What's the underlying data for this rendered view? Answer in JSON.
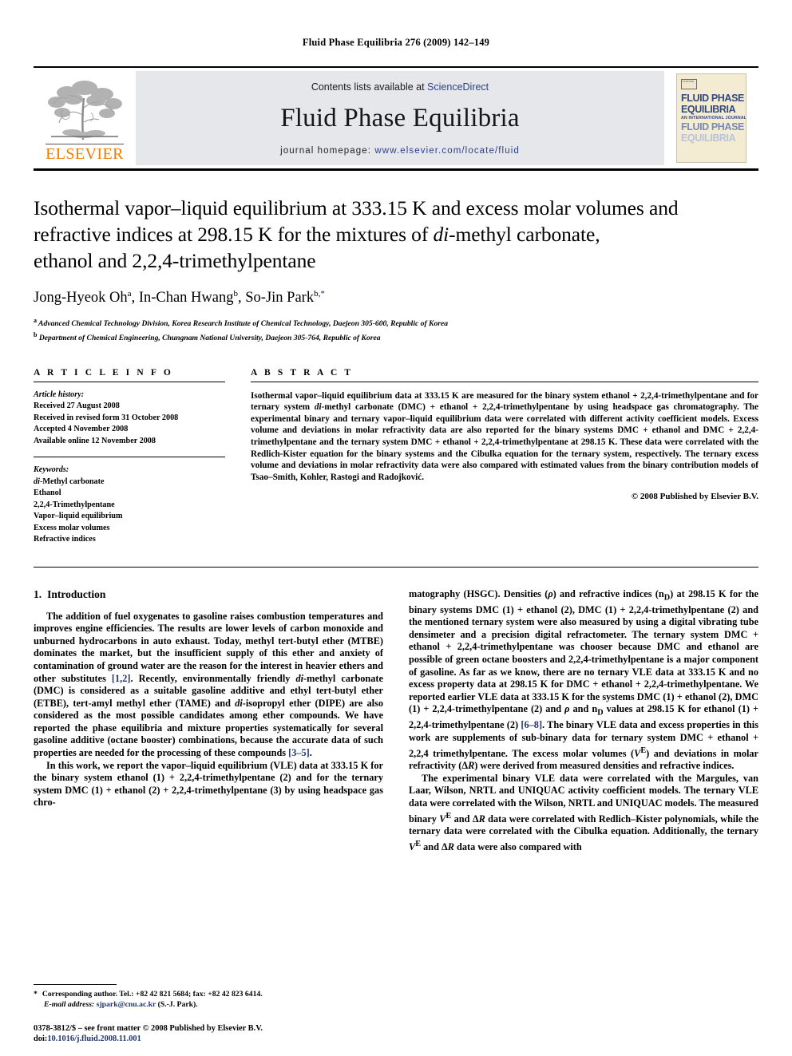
{
  "running_head": "Fluid Phase Equilibria 276 (2009) 142–149",
  "masthead": {
    "contents_prefix": "Contents lists available at ",
    "sciencedirect": "ScienceDirect",
    "journal_name": "Fluid Phase Equilibria",
    "homepage_prefix": "journal homepage:",
    "homepage_url": "www.elsevier.com/locate/fluid",
    "publisher_logo_text": "ELSEVIER",
    "logo_color": "#f07c00",
    "link_color": "#2b3f8c",
    "band_color": "#e6e7ea",
    "cover": {
      "line1": "FLUID PHASE",
      "line2": "EQUILIBRIA",
      "subtitle": "AN INTERNATIONAL JOURNAL",
      "line3": "FLUID PHASE",
      "line4": "EQUILIBRIA",
      "badge_text": "ELSEVIER",
      "bg_color": "#f3ecd2",
      "text_color": "#33487f"
    }
  },
  "article": {
    "title_line1": "Isothermal vapor–liquid equilibrium at 333.15 K and excess molar volumes and",
    "title_line2_a": "refractive indices at 298.15 K for the mixtures of ",
    "title_line2_italic": "di",
    "title_line2_b": "-methyl carbonate,",
    "title_line3": "ethanol and 2,2,4-trimethylpentane",
    "authors": [
      {
        "name": "Jong-Hyeok Oh",
        "marks": "a",
        "sep": ", "
      },
      {
        "name": "In-Chan Hwang",
        "marks": "b",
        "sep": ", "
      },
      {
        "name": "So-Jin Park",
        "marks": "b,",
        "star": "*",
        "sep": ""
      }
    ],
    "affiliations": [
      {
        "mark": "a",
        "text": "Advanced Chemical Technology Division, Korea Research Institute of Chemical Technology, Daejeon 305-600, Republic of Korea"
      },
      {
        "mark": "b",
        "text": "Department of Chemical Engineering, Chungnam National University, Daejeon 305-764, Republic of Korea"
      }
    ]
  },
  "info": {
    "heading": "A R T I C L E   I N F O",
    "history_label": "Article history:",
    "history": [
      "Received 27 August 2008",
      "Received in revised form 31 October 2008",
      "Accepted 4 November 2008",
      "Available online 12 November 2008"
    ],
    "keywords_label": "Keywords:",
    "keywords": [
      {
        "italic": "di",
        "rest": "-Methyl carbonate"
      },
      {
        "italic": "",
        "rest": "Ethanol"
      },
      {
        "italic": "",
        "rest": "2,2,4-Trimethylpentane"
      },
      {
        "italic": "",
        "rest": "Vapor–liquid equilibrium"
      },
      {
        "italic": "",
        "rest": "Excess molar volumes"
      },
      {
        "italic": "",
        "rest": "Refractive indices"
      }
    ]
  },
  "abstract": {
    "heading": "A B S T R A C T",
    "part1": "Isothermal vapor–liquid equilibrium data at 333.15 K are measured for the binary system ethanol + 2,2,4-trimethylpentane and for ternary system ",
    "italic1": "di",
    "part2": "-methyl carbonate (DMC) + ethanol + 2,2,4-trimethylpentane by using headspace gas chromatography. The experimental binary and ternary vapor–liquid equilibrium data were correlated with different activity coefficient models. Excess volume and deviations in molar refractivity data are also reported for the binary systems DMC + ethanol and DMC + 2,2,4-trimethylpentane and the ternary system DMC + ethanol + 2,2,4-trimethylpentane at 298.15 K. These data were correlated with the Redlich-Kister equation for the binary systems and the Cibulka equation for the ternary system, respectively. The ternary excess volume and deviations in molar refractivity data were also compared with estimated values from the binary contribution models of Tsao–Smith, Kohler, Rastogi and Radojković.",
    "copyright": "© 2008 Published by Elsevier B.V."
  },
  "body": {
    "section_number": "1.",
    "section_title": "Introduction",
    "left_paragraphs": [
      {
        "segments": [
          {
            "t": "The addition of fuel oxygenates to gasoline raises combustion temperatures and improves engine efficiencies. The results are lower levels of carbon monoxide and unburned hydrocarbons in auto exhaust. Today, methyl tert-butyl ether (MTBE) dominates the market, but the insufficient supply of this ether and anxiety of contamination of ground water are the reason for the interest in heavier ethers and other substitutes ",
            "s": "n"
          },
          {
            "t": "[1,2]",
            "s": "ref"
          },
          {
            "t": ". Recently, environmentally friendly ",
            "s": "n"
          },
          {
            "t": "di",
            "s": "i"
          },
          {
            "t": "-methyl carbonate (DMC) is considered as a suitable gasoline additive and ethyl tert-butyl ether (ETBE), tert-amyl methyl ether (TAME) and ",
            "s": "n"
          },
          {
            "t": "di",
            "s": "i"
          },
          {
            "t": "-isopropyl ether (DIPE) are also considered as the most possible candidates among ether compounds. We have reported the phase equilibria and mixture properties systematically for several gasoline additive (octane booster) combinations, because the accurate data of such properties are needed for the processing of these compounds ",
            "s": "n"
          },
          {
            "t": "[3–5]",
            "s": "ref"
          },
          {
            "t": ".",
            "s": "n"
          }
        ]
      },
      {
        "segments": [
          {
            "t": "In this work, we report the vapor–liquid equilibrium (VLE) data at 333.15 K for the binary system ethanol (1) + 2,2,4-trimethylpentane (2) and for the ternary system DMC (1) + ethanol (2) + 2,2,4-trimethylpentane (3) by using headspace gas chro-",
            "s": "n"
          }
        ]
      }
    ],
    "right_paragraphs": [
      {
        "segments": [
          {
            "t": "matography (HSGC). Densities (",
            "s": "n"
          },
          {
            "t": "ρ",
            "s": "i"
          },
          {
            "t": ") and refractive indices (n",
            "s": "n"
          },
          {
            "t": "D",
            "s": "sub"
          },
          {
            "t": ") at 298.15 K for the binary systems DMC (1) + ethanol (2), DMC (1) + 2,2,4-trimethylpentane (2) and the mentioned ternary system were also measured by using a digital vibrating tube densimeter and a precision digital refractometer. The ternary system DMC + ethanol + 2,2,4-trimethylpentane was chooser because DMC and ethanol are possible of green octane boosters and 2,2,4-trimethylpentane is a major component of gasoline. As far as we know, there are no ternary VLE data at 333.15 K and no excess property data at 298.15 K for DMC + ethanol + 2,2,4-trimethylpentane. We reported earlier VLE data at 333.15 K for the systems DMC (1) + ethanol (2), DMC (1) + 2,2,4-trimethylpentane (2) and ",
            "s": "n"
          },
          {
            "t": "ρ",
            "s": "i"
          },
          {
            "t": " and n",
            "s": "n"
          },
          {
            "t": "D",
            "s": "sub"
          },
          {
            "t": " values at 298.15 K for ethanol (1) + 2,2,4-trimethylpentane (2) ",
            "s": "n"
          },
          {
            "t": "[6–8]",
            "s": "ref"
          },
          {
            "t": ". The binary VLE data and excess properties in this work are supplements of sub-binary data for ternary system DMC + ethanol + 2,2,4 trimethylpentane. The excess molar volumes (",
            "s": "n"
          },
          {
            "t": "V",
            "s": "i"
          },
          {
            "t": "E",
            "s": "sup"
          },
          {
            "t": ") and deviations in molar refractivity (Δ",
            "s": "n"
          },
          {
            "t": "R",
            "s": "i"
          },
          {
            "t": ") were derived from measured densities and refractive indices.",
            "s": "n"
          }
        ]
      },
      {
        "segments": [
          {
            "t": "The experimental binary VLE data were correlated with the Margules, van Laar, Wilson, NRTL and UNIQUAC activity coefficient models. The ternary VLE data were correlated with the Wilson, NRTL and UNIQUAC models. The measured binary ",
            "s": "n"
          },
          {
            "t": "V",
            "s": "i"
          },
          {
            "t": "E",
            "s": "sup"
          },
          {
            "t": " and Δ",
            "s": "n"
          },
          {
            "t": "R",
            "s": "i"
          },
          {
            "t": " data were correlated with Redlich–Kister polynomials, while the ternary data were correlated with the Cibulka equation. Additionally, the ternary ",
            "s": "n"
          },
          {
            "t": "V",
            "s": "i"
          },
          {
            "t": "E",
            "s": "sup"
          },
          {
            "t": " and Δ",
            "s": "n"
          },
          {
            "t": "R",
            "s": "i"
          },
          {
            "t": " data were also compared with",
            "s": "n"
          }
        ]
      }
    ]
  },
  "footnote": {
    "star": "*",
    "line1": "Corresponding author. Tel.: +82 42 821 5684; fax: +82 42 823 6414.",
    "email_label": "E-mail address:",
    "email": "sjpark@cnu.ac.kr",
    "email_suffix": "(S.-J. Park)."
  },
  "imprint": {
    "issn_line": "0378-3812/$ – see front matter © 2008 Published by Elsevier B.V.",
    "doi_label": "doi:",
    "doi_value": "10.1016/j.fluid.2008.11.001"
  }
}
